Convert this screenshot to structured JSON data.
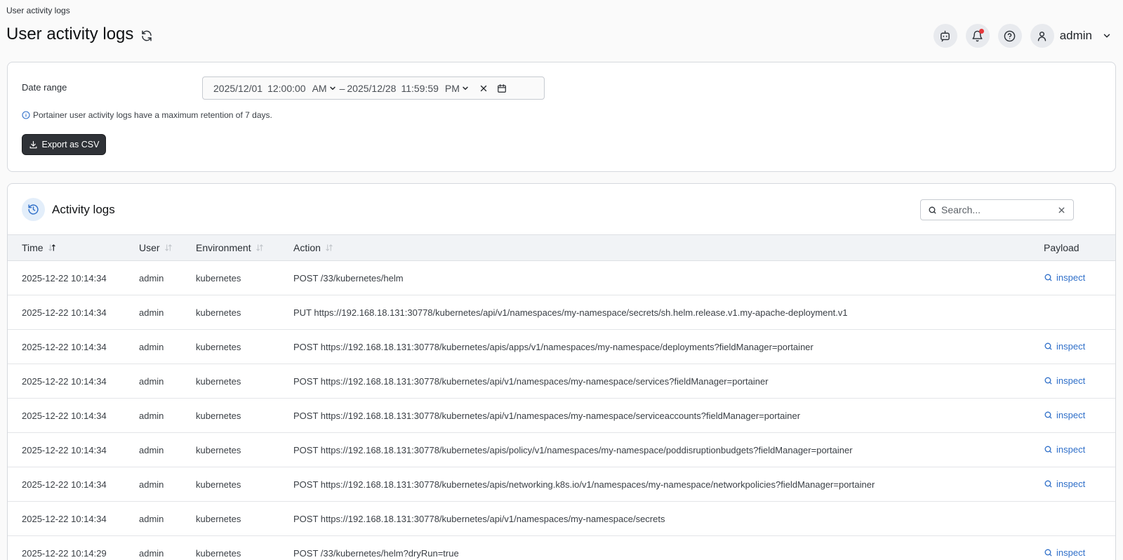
{
  "breadcrumb": "User activity logs",
  "page_title": "User activity logs",
  "user": {
    "name": "admin"
  },
  "filter": {
    "date_label": "Date range",
    "start_date": "2025/12/01",
    "start_time": "12:00:00",
    "start_ampm": "AM",
    "separator": "–",
    "end_date": "2025/12/28",
    "end_time": "11:59:59",
    "end_ampm": "PM",
    "info": "Portainer user activity logs have a maximum retention of 7 days.",
    "export_label": "Export as CSV"
  },
  "logs": {
    "title": "Activity logs",
    "search_placeholder": "Search...",
    "columns": {
      "time": "Time",
      "user": "User",
      "environment": "Environment",
      "action": "Action",
      "payload": "Payload"
    },
    "inspect_label": "inspect",
    "rows": [
      {
        "time": "2025-12-22 10:14:34",
        "user": "admin",
        "environment": "kubernetes",
        "action": "POST /33/kubernetes/helm",
        "inspect": "inspect"
      },
      {
        "time": "2025-12-22 10:14:34",
        "user": "admin",
        "environment": "kubernetes",
        "action": "PUT https://192.168.18.131:30778/kubernetes/api/v1/namespaces/my-namespace/secrets/sh.helm.release.v1.my-apache-deployment.v1",
        "inspect": ""
      },
      {
        "time": "2025-12-22 10:14:34",
        "user": "admin",
        "environment": "kubernetes",
        "action": "POST https://192.168.18.131:30778/kubernetes/apis/apps/v1/namespaces/my-namespace/deployments?fieldManager=portainer",
        "inspect": "inspect"
      },
      {
        "time": "2025-12-22 10:14:34",
        "user": "admin",
        "environment": "kubernetes",
        "action": "POST https://192.168.18.131:30778/kubernetes/api/v1/namespaces/my-namespace/services?fieldManager=portainer",
        "inspect": "inspect"
      },
      {
        "time": "2025-12-22 10:14:34",
        "user": "admin",
        "environment": "kubernetes",
        "action": "POST https://192.168.18.131:30778/kubernetes/api/v1/namespaces/my-namespace/serviceaccounts?fieldManager=portainer",
        "inspect": "inspect"
      },
      {
        "time": "2025-12-22 10:14:34",
        "user": "admin",
        "environment": "kubernetes",
        "action": "POST https://192.168.18.131:30778/kubernetes/apis/policy/v1/namespaces/my-namespace/poddisruptionbudgets?fieldManager=portainer",
        "inspect": "inspect"
      },
      {
        "time": "2025-12-22 10:14:34",
        "user": "admin",
        "environment": "kubernetes",
        "action": "POST https://192.168.18.131:30778/kubernetes/apis/networking.k8s.io/v1/namespaces/my-namespace/networkpolicies?fieldManager=portainer",
        "inspect": "inspect"
      },
      {
        "time": "2025-12-22 10:14:34",
        "user": "admin",
        "environment": "kubernetes",
        "action": "POST https://192.168.18.131:30778/kubernetes/api/v1/namespaces/my-namespace/secrets",
        "inspect": ""
      },
      {
        "time": "2025-12-22 10:14:29",
        "user": "admin",
        "environment": "kubernetes",
        "action": "POST /33/kubernetes/helm?dryRun=true",
        "inspect": "inspect"
      }
    ]
  },
  "colors": {
    "accent": "#2f6fc9",
    "export_bg": "#2f3237",
    "notification": "#e5383b"
  }
}
